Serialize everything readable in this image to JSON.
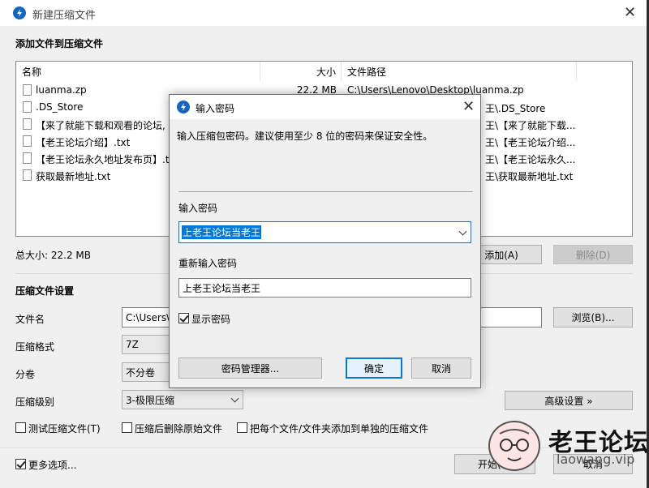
{
  "window": {
    "title": "新建压缩文件",
    "close": "✕"
  },
  "section_add": {
    "title": "添加文件到压缩文件"
  },
  "list": {
    "headers": {
      "name": "名称",
      "size": "大小",
      "path": "文件路径"
    },
    "rows": [
      {
        "name": "luanma.zp",
        "size": "22.2 MB",
        "path": "C:\\Users\\Lenovo\\Desktop\\luanma.zp"
      },
      {
        "name": ".DS_Store",
        "size": "",
        "path": "王\\.DS_Store"
      },
      {
        "name": "【来了就能下载和观看的论坛,",
        "size": "",
        "path": "王\\【来了就能下载..."
      },
      {
        "name": "【老王论坛介绍】.txt",
        "size": "",
        "path": "王\\【老王论坛介绍..."
      },
      {
        "name": "【老王论坛永久地址发布页】.t",
        "size": "",
        "path": "王\\【老王论坛永久..."
      },
      {
        "name": "获取最新地址.txt",
        "size": "",
        "path": "王\\获取最新地址.txt"
      }
    ]
  },
  "total": {
    "label": "总大小: 22.2 MB"
  },
  "buttons": {
    "add": "添加(A)",
    "delete": "删除(D)",
    "browse": "浏览(B)...",
    "advanced": "高级设置 »",
    "start": "开始(S)",
    "cancel": "取消"
  },
  "settings": {
    "title": "压缩文件设置",
    "filename_label": "文件名",
    "filename_value": "C:\\Users\\",
    "format_label": "压缩格式",
    "format_value": "7Z",
    "volume_label": "分卷",
    "volume_value": "不分卷",
    "level_label": "压缩级别",
    "level_value": "3-极限压缩"
  },
  "options": {
    "test": "测试压缩文件(T)",
    "delete_orig": "压缩后删除原始文件",
    "each_file": "把每个文件/文件夹添加到单独的压缩文件",
    "more": "更多选项..."
  },
  "dialog": {
    "title": "输入密码",
    "desc": "输入压缩包密码。建议使用至少 8 位的密码来保证安全性。",
    "pw_label": "输入密码",
    "pw_value": "上老王论坛当老王",
    "repw_label": "重新输入密码",
    "repw_value": "上老王论坛当老王",
    "show_pw": "显示密码",
    "manager": "密码管理器...",
    "ok": "确定",
    "cancel": "取消",
    "close": "✕"
  },
  "watermark": {
    "name": "老王论坛",
    "url": "laowang.vip"
  },
  "colors": {
    "accent": "#0078d7",
    "selection": "#cce8ff",
    "icon_blue": "#1565c0"
  }
}
